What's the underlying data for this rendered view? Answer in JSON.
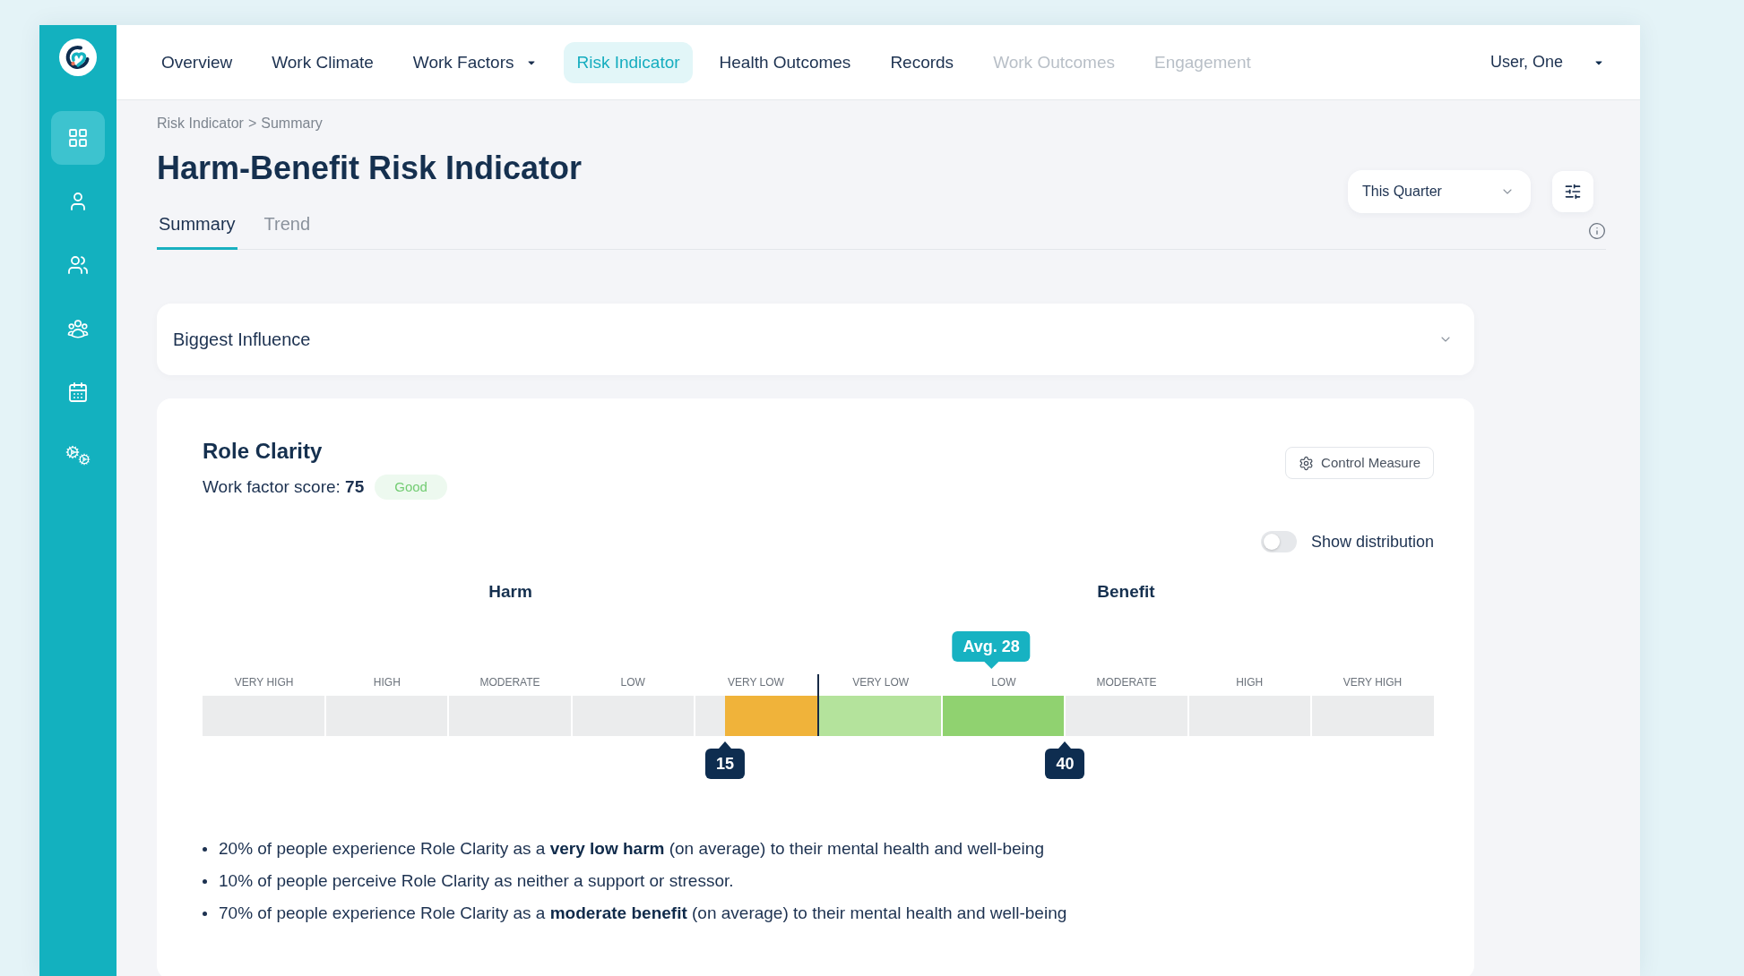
{
  "sidebar": {
    "items": [
      {
        "selected": true
      },
      {
        "selected": false
      },
      {
        "selected": false
      },
      {
        "selected": false
      },
      {
        "selected": false
      },
      {
        "selected": false
      }
    ]
  },
  "nav": {
    "items": [
      {
        "label": "Overview",
        "selected": false,
        "disabled": false,
        "has_menu": false
      },
      {
        "label": "Work Climate",
        "selected": false,
        "disabled": false,
        "has_menu": false
      },
      {
        "label": "Work Factors",
        "selected": false,
        "disabled": false,
        "has_menu": true
      },
      {
        "label": "Risk Indicator",
        "selected": true,
        "disabled": false,
        "has_menu": false
      },
      {
        "label": "Health Outcomes",
        "selected": false,
        "disabled": false,
        "has_menu": false
      },
      {
        "label": "Records",
        "selected": false,
        "disabled": false,
        "has_menu": false
      },
      {
        "label": "Work Outcomes",
        "selected": false,
        "disabled": true,
        "has_menu": false
      },
      {
        "label": "Engagement",
        "selected": false,
        "disabled": true,
        "has_menu": false
      }
    ]
  },
  "user_menu": {
    "name": "User, One"
  },
  "breadcrumb": {
    "items": [
      "Risk Indicator",
      "Summary"
    ],
    "separator": ">"
  },
  "page_title": "Harm-Benefit Risk Indicator",
  "period_select": {
    "value": "This Quarter"
  },
  "tabs": [
    {
      "label": "Summary",
      "selected": true
    },
    {
      "label": "Trend",
      "selected": false
    }
  ],
  "sections": [
    {
      "title": "Biggest Influence",
      "expanded": false
    }
  ],
  "work_factor_card": {
    "title": "Role Clarity",
    "score_text": "Work factor score: **75**",
    "rating": "Good",
    "control_button": "Control Measure",
    "distribution_toggle": {
      "label": "Show distribution",
      "on": false
    },
    "scale": {
      "harm": {
        "title": "Harm",
        "level": 0.15,
        "marker": "15",
        "segments": [
          {
            "label": "VERY HIGH"
          },
          {
            "label": "HIGH"
          },
          {
            "label": "MODERATE"
          },
          {
            "label": "LOW"
          },
          {
            "label": "VERY LOW",
            "color": "#f0b33a"
          }
        ]
      },
      "benefit": {
        "title": "Benefit",
        "level": 0.4,
        "marker": "40",
        "segments": [
          {
            "label": "VERY LOW",
            "color": "#b4e39c"
          },
          {
            "label": "LOW",
            "color": "#90d270"
          },
          {
            "label": "MODERATE"
          },
          {
            "label": "HIGH"
          },
          {
            "label": "VERY HIGH"
          }
        ]
      },
      "average": {
        "label": "Avg. 28",
        "level": 0.28
      }
    },
    "findings": [
      "20% of people experience Role Clarity as a **very low harm** (on average) to their mental health and well-being",
      "10% of people perceive Role Clarity as neither a support or stressor.",
      "70% of people experience Role Clarity as a **moderate benefit** (on average) to their mental health and well-being"
    ]
  }
}
